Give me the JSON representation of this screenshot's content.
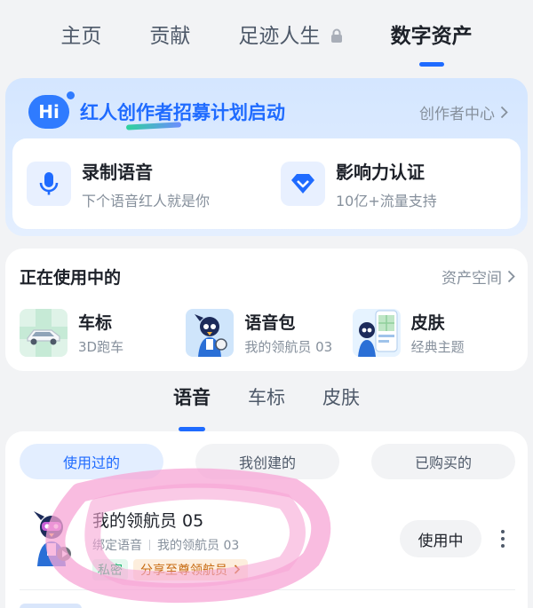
{
  "top_tabs": [
    {
      "label": "主页",
      "active": false
    },
    {
      "label": "贡献",
      "active": false
    },
    {
      "label": "足迹人生",
      "active": false,
      "locked": true
    },
    {
      "label": "数字资产",
      "active": true
    }
  ],
  "creator": {
    "badge": "Hi",
    "title": "红人创作者招募计划启动",
    "center_link": "创作者中心",
    "features": [
      {
        "title": "录制语音",
        "subtitle": "下个语音红人就是你",
        "icon": "microphone-icon"
      },
      {
        "title": "影响力认证",
        "subtitle": "10亿+流量支持",
        "icon": "verified-shield-icon"
      }
    ]
  },
  "in_use": {
    "title": "正在使用中的",
    "link": "资产空间",
    "items": [
      {
        "title": "车标",
        "subtitle": "3D跑车",
        "thumb": "car-thumbnail"
      },
      {
        "title": "语音包",
        "subtitle": "我的领航员 03",
        "thumb": "voice-character-thumbnail"
      },
      {
        "title": "皮肤",
        "subtitle": "经典主题",
        "thumb": "skin-theme-thumbnail"
      }
    ]
  },
  "category_tabs": [
    {
      "label": "语音",
      "active": true
    },
    {
      "label": "车标",
      "active": false
    },
    {
      "label": "皮肤",
      "active": false
    }
  ],
  "filters": [
    {
      "label": "使用过的",
      "active": true
    },
    {
      "label": "我创建的",
      "active": false
    },
    {
      "label": "已购买的",
      "active": false
    }
  ],
  "voice_item": {
    "title": "我的领航员 05",
    "meta_1": "绑定语音",
    "meta_2": "我的领航员 03",
    "badge_private": "私密",
    "badge_share": "分享至尊领航员",
    "action": "使用中"
  },
  "colors": {
    "accent": "#1f6bff",
    "creator_bg": "#d4e6ff",
    "private_green": "#16b26b",
    "share_orange": "#c76a11",
    "highlighter_pink": "#f7a6d6"
  }
}
